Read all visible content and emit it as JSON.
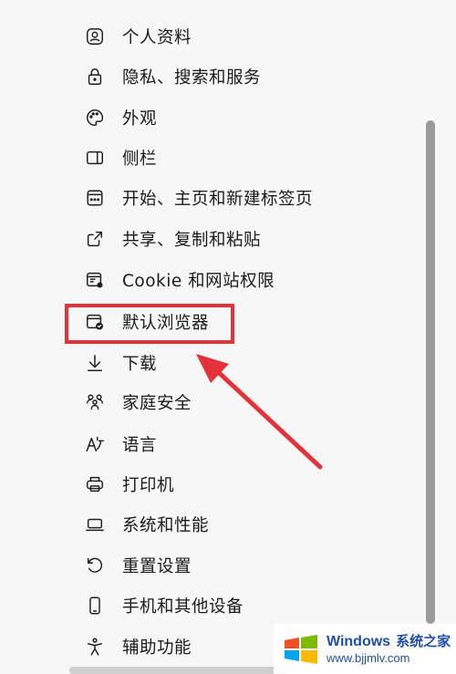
{
  "menu": {
    "items": [
      {
        "label": "个人资料",
        "icon": "profile-icon"
      },
      {
        "label": "隐私、搜索和服务",
        "icon": "lock-icon"
      },
      {
        "label": "外观",
        "icon": "palette-icon"
      },
      {
        "label": "侧栏",
        "icon": "sidebar-icon"
      },
      {
        "label": "开始、主页和新建标签页",
        "icon": "start-page-icon"
      },
      {
        "label": "共享、复制和粘贴",
        "icon": "share-icon"
      },
      {
        "label": "Cookie 和网站权限",
        "icon": "cookie-permissions-icon"
      },
      {
        "label": "默认浏览器",
        "icon": "default-browser-icon"
      },
      {
        "label": "下载",
        "icon": "download-icon"
      },
      {
        "label": "家庭安全",
        "icon": "family-icon"
      },
      {
        "label": "语言",
        "icon": "language-icon"
      },
      {
        "label": "打印机",
        "icon": "printer-icon"
      },
      {
        "label": "系统和性能",
        "icon": "laptop-icon"
      },
      {
        "label": "重置设置",
        "icon": "reset-icon"
      },
      {
        "label": "手机和其他设备",
        "icon": "phone-icon"
      },
      {
        "label": "辅助功能",
        "icon": "accessibility-icon"
      }
    ]
  },
  "annotation": {
    "highlight_color": "#e3323a",
    "highlighted_item": "默认浏览器"
  },
  "watermark": {
    "brand": "Windows",
    "brand_cn": "系统之家",
    "url": "www.bjjmlv.com"
  }
}
